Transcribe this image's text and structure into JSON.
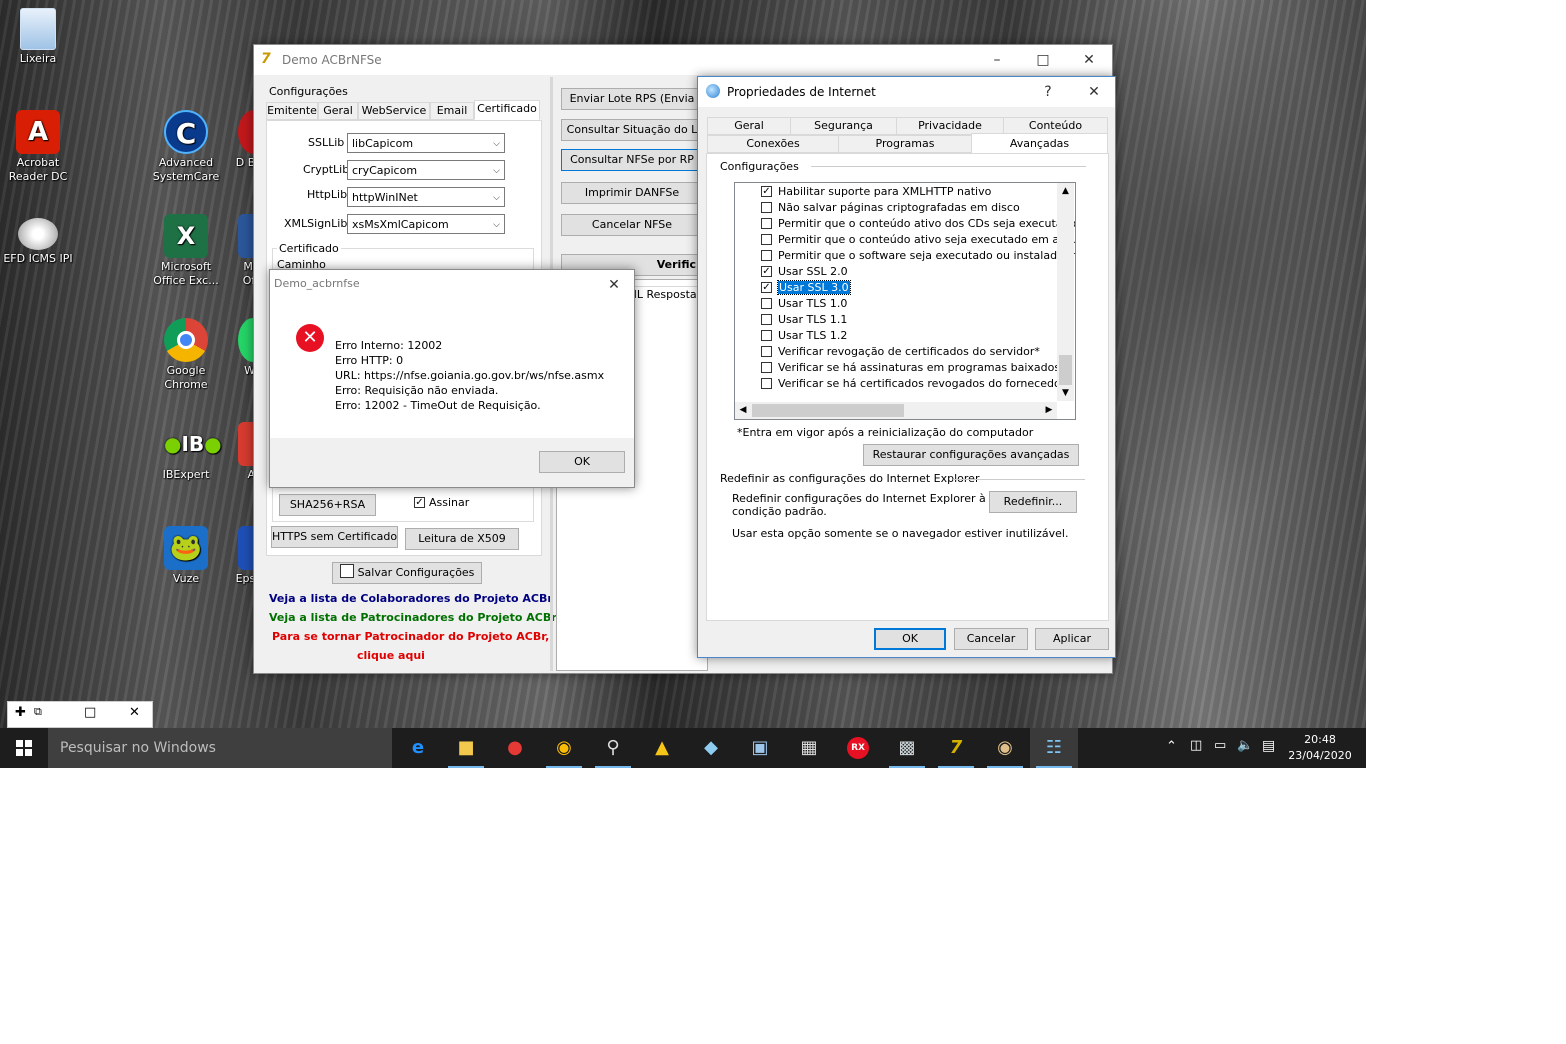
{
  "desktop_icons": [
    {
      "label": "Lixeira"
    },
    {
      "label": "Acrobat Reader DC"
    },
    {
      "label": "Advanced SystemCare"
    },
    {
      "label": "D Bo"
    },
    {
      "label": "EFD ICMS IPI"
    },
    {
      "label": "Microsoft Office Exc..."
    },
    {
      "label": "Mic Offi"
    },
    {
      "label": "Google Chrome"
    },
    {
      "label": "Wh"
    },
    {
      "label": "IBExpert"
    },
    {
      "label": "An"
    },
    {
      "label": "Vuze"
    },
    {
      "label": "Epso"
    }
  ],
  "acbr": {
    "title": "Demo ACBrNFSe",
    "group_config": "Configurações",
    "tabs": [
      "Emitente",
      "Geral",
      "WebService",
      "Email",
      "Certificado"
    ],
    "fields": [
      {
        "label": "SSLLib",
        "value": "libCapicom"
      },
      {
        "label": "CryptLib",
        "value": "cryCapicom"
      },
      {
        "label": "HttpLib",
        "value": "httpWinINet"
      },
      {
        "label": "XMLSignLib",
        "value": "xsMsXmlCapicom"
      }
    ],
    "cert_group": "Certificado",
    "caminho": "Caminho",
    "sha_btn": "SHA256+RSA",
    "assinar": "Assinar",
    "https_btn": "HTTPS sem Certificado",
    "x509_btn": "Leitura de X509",
    "salvar_btn": "Salvar Configurações",
    "actions": [
      "Enviar Lote RPS (Envia",
      "Consultar Situação do L",
      "Consultar NFSe por RP",
      "Imprimir DANFSe",
      "Cancelar NFSe",
      "Verific"
    ],
    "xml_resposta": "ML Resposta",
    "links": [
      {
        "text": "Veja a lista de Colaboradores do Projeto ACBr",
        "color": "#000080"
      },
      {
        "text": "Veja a lista de Patrocinadores do Projeto ACBr",
        "color": "#007000"
      },
      {
        "text": "Para se tornar Patrocinador do Projeto ACBr,",
        "color": "#e00000"
      },
      {
        "text": "clique aqui",
        "color": "#e00000"
      }
    ]
  },
  "error_dialog": {
    "title": "Demo_acbrnfse",
    "lines": [
      "Erro Interno: 12002",
      "Erro HTTP: 0",
      "URL: https://nfse.goiania.go.gov.br/ws/nfse.asmx",
      "Erro: Requisição não enviada.",
      "Erro: 12002 - TimeOut de Requisição."
    ],
    "ok": "OK"
  },
  "inet": {
    "title": "Propriedades de Internet",
    "help": "?",
    "tabs_row1": [
      "Geral",
      "Segurança",
      "Privacidade",
      "Conteúdo"
    ],
    "tabs_row2": [
      "Conexões",
      "Programas",
      "Avançadas"
    ],
    "config_label": "Configurações",
    "options": [
      {
        "text": "Habilitar suporte para XMLHTTP nativo",
        "checked": "✓"
      },
      {
        "text": "Não salvar páginas criptografadas em disco",
        "checked": ""
      },
      {
        "text": "Permitir que o conteúdo ativo dos CDs seja executado no",
        "checked": ""
      },
      {
        "text": "Permitir que o conteúdo ativo seja executado em arquivos",
        "checked": ""
      },
      {
        "text": "Permitir que o software seja executado ou instalado mesm",
        "checked": ""
      },
      {
        "text": "Usar SSL 2.0",
        "checked": "✓"
      },
      {
        "text": "Usar SSL 3.0",
        "checked": "✓"
      },
      {
        "text": "Usar TLS 1.0",
        "checked": ""
      },
      {
        "text": "Usar TLS 1.1",
        "checked": ""
      },
      {
        "text": "Usar TLS 1.2",
        "checked": ""
      },
      {
        "text": "Verificar revogação de certificados do servidor*",
        "checked": ""
      },
      {
        "text": "Verificar se há assinaturas em programas baixados",
        "checked": ""
      },
      {
        "text": "Verificar se há certificados revogados do fornecedor",
        "checked": ""
      }
    ],
    "footnote": "*Entra em vigor após a reinicialização do computador",
    "restore_btn": "Restaurar configurações avançadas",
    "reset_group": "Redefinir as configurações do Internet Explorer",
    "reset_text1": "Redefinir configurações do Internet Explorer à",
    "reset_text2": "condição padrão.",
    "reset_btn": "Redefinir...",
    "reset_note": "Usar esta opção somente se o navegador estiver inutilizável.",
    "ok": "OK",
    "cancel": "Cancelar",
    "apply": "Aplicar"
  },
  "taskbar": {
    "search_placeholder": "Pesquisar no Windows",
    "time": "20:48",
    "date": "23/04/2020"
  }
}
